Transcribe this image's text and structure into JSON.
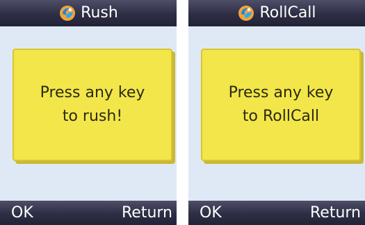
{
  "screens": [
    {
      "title": "Rush",
      "icon": "app-logo-icon",
      "prompt_line1": "Press any key",
      "prompt_line2": "to rush!",
      "softkey_left": "OK",
      "softkey_right": "Return"
    },
    {
      "title": "RollCall",
      "icon": "app-logo-icon",
      "prompt_line1": "Press any key",
      "prompt_line2": "to RollCall",
      "softkey_left": "OK",
      "softkey_right": "Return"
    }
  ],
  "colors": {
    "titlebar": "#2d2d44",
    "content_background": "#dfe9f6",
    "card": "#f3e64a",
    "card_border": "#d8c52e",
    "text_on_bar": "#ffffff"
  }
}
